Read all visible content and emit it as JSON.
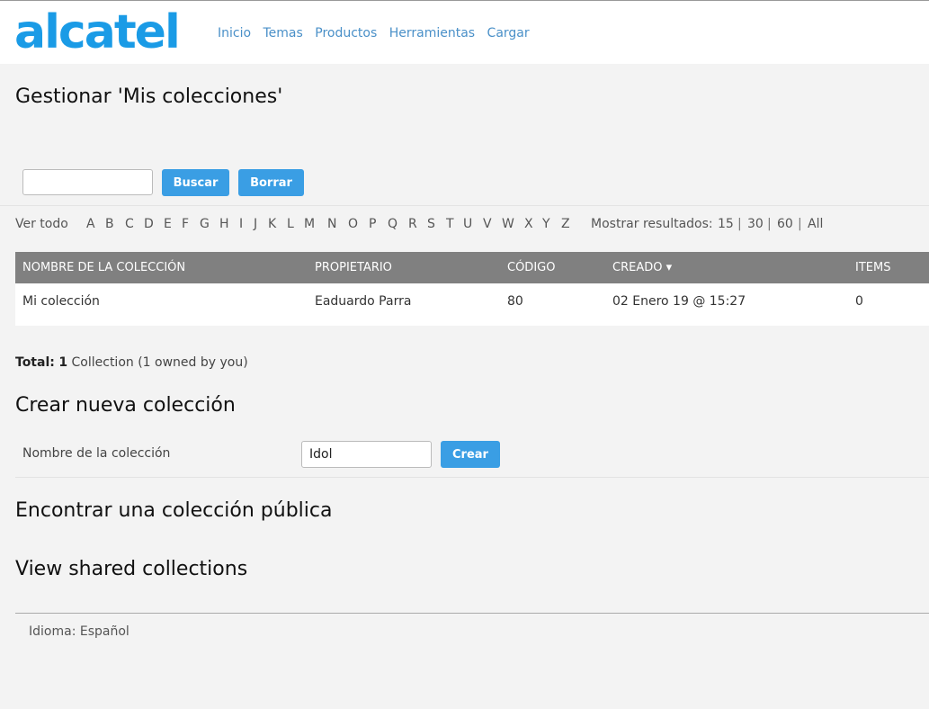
{
  "header": {
    "logo_text": "alcatel",
    "nav": [
      "Inicio",
      "Temas",
      "Productos",
      "Herramientas",
      "Cargar"
    ],
    "brand_color": "#1a9be6"
  },
  "page": {
    "title": "Gestionar 'Mis colecciones'"
  },
  "search": {
    "value": "",
    "search_button": "Buscar",
    "clear_button": "Borrar"
  },
  "alphabet": {
    "view_all": "Ver todo",
    "letters": [
      "A",
      "B",
      "C",
      "D",
      "E",
      "F",
      "G",
      "H",
      "I",
      "J",
      "K",
      "L",
      "M",
      "N",
      "O",
      "P",
      "Q",
      "R",
      "S",
      "T",
      "U",
      "V",
      "W",
      "X",
      "Y",
      "Z"
    ],
    "results_label": "Mostrar resultados:",
    "results_options": [
      "15",
      "30",
      "60",
      "All"
    ]
  },
  "table": {
    "headers": [
      "NOMBRE DE LA COLECCIÓN",
      "PROPIETARIO",
      "CÓDIGO",
      "CREADO ▾",
      "ITEMS"
    ],
    "rows": [
      [
        "Mi colección",
        "Eaduardo Parra",
        "80",
        "02 Enero 19 @ 15:27",
        "0"
      ]
    ]
  },
  "total": {
    "label": "Total:",
    "count": "1",
    "text": "Collection (1 owned by you)"
  },
  "create": {
    "title": "Crear nueva colección",
    "label": "Nombre de la colección",
    "value": "Idol",
    "button": "Crear"
  },
  "sections": {
    "find_public": "Encontrar una colección pública",
    "view_shared": "View shared collections"
  },
  "footer": {
    "language": "Idioma: Español"
  }
}
